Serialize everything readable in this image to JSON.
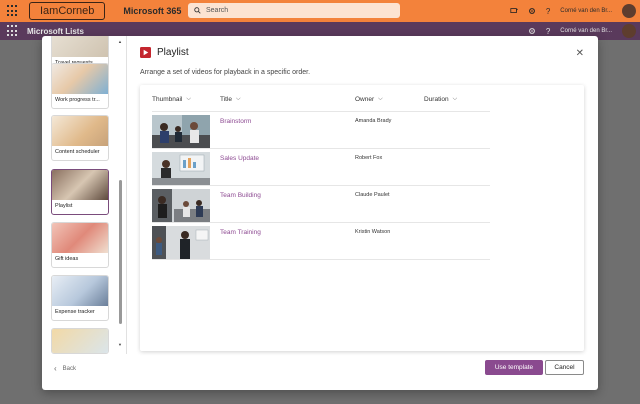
{
  "suite": {
    "brand": "IamCorneb",
    "product": "Microsoft 365",
    "search_placeholder": "Search",
    "user": "Corné van den Br..."
  },
  "app": {
    "title": "Microsoft Lists",
    "user": "Corné van den Br..."
  },
  "sidebar": {
    "items": [
      {
        "label": "Travel requests"
      },
      {
        "label": "Work progress tr..."
      },
      {
        "label": "Content scheduler"
      },
      {
        "label": "Playlist",
        "selected": true
      },
      {
        "label": "Gift ideas"
      },
      {
        "label": "Expense tracker"
      },
      {
        "label": ""
      }
    ]
  },
  "dialog": {
    "title": "Playlist",
    "description": "Arrange a set of videos for playback in a specific order.",
    "columns": {
      "thumbnail": "Thumbnail",
      "title": "Title",
      "owner": "Owner",
      "duration": "Duration"
    },
    "rows": [
      {
        "title": "Brainstorm",
        "owner": "Amanda Brady"
      },
      {
        "title": "Sales Update",
        "owner": "Robert Fox"
      },
      {
        "title": "Team Building",
        "owner": "Claude Paulet"
      },
      {
        "title": "Team Training",
        "owner": "Kristin Watson"
      }
    ],
    "back_label": "Back",
    "use_template_label": "Use template",
    "cancel_label": "Cancel"
  },
  "colors": {
    "suite_bar": "#f3823b",
    "app_bar": "#5a3a5c",
    "accent": "#8a4a8f",
    "link": "#8d4a92",
    "playlist_icon": "#c4262e"
  }
}
